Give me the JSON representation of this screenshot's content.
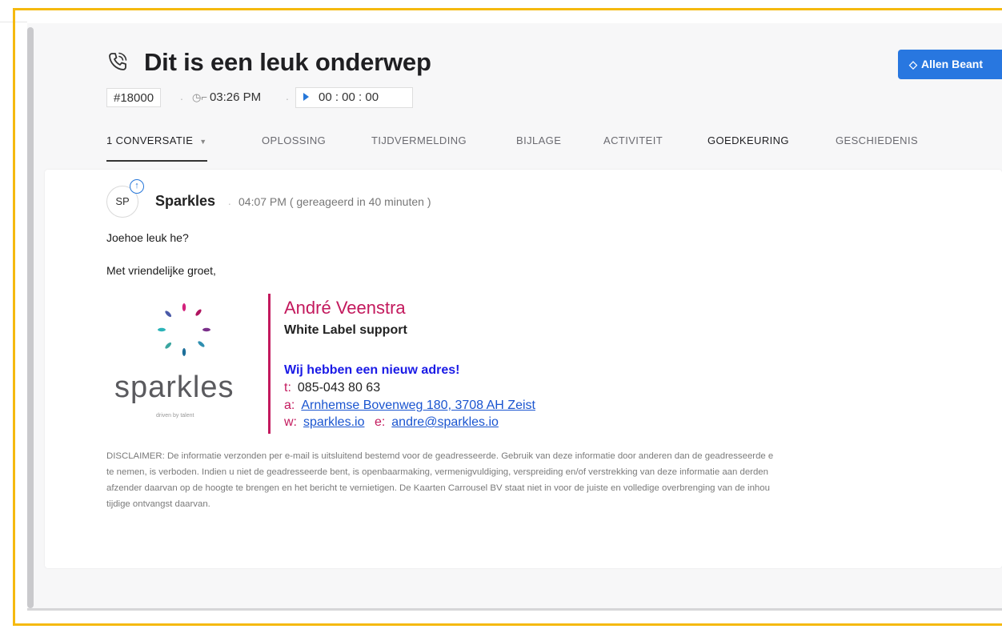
{
  "header": {
    "title": "Dit is een leuk onderwep",
    "ticket_id": "#18000",
    "time": "03:26 PM",
    "timer": "00 : 00 : 00",
    "assign_button": "Allen Beant"
  },
  "tabs": [
    {
      "label": "1 CONVERSATIE"
    },
    {
      "label": "OPLOSSING"
    },
    {
      "label": "TIJDVERMELDING"
    },
    {
      "label": "BIJLAGE"
    },
    {
      "label": "ACTIVITEIT"
    },
    {
      "label": "GOEDKEURING"
    },
    {
      "label": "GESCHIEDENIS"
    }
  ],
  "message": {
    "avatar_initials": "SP",
    "sender": "Sparkles",
    "sent_info": "04:07 PM ( gereageerd in 40 minuten )",
    "body_line1": "Joehoe leuk he?",
    "body_line2": "Met vriendelijke groet,"
  },
  "signature": {
    "logo_word": "sparkles",
    "logo_tagline": "driven by talent",
    "name": "André Veenstra",
    "role": "White Label support",
    "news": "Wij hebben een nieuw adres!",
    "phone_key": "t:",
    "phone": "085-043 80 63",
    "address_key": "a:",
    "address": "Arnhemse Bovenweg 180, 3708 AH Zeist",
    "web_key": "w:",
    "web": "sparkles.io",
    "email_key": "e:",
    "email": "andre@sparkles.io"
  },
  "disclaimer": [
    "DISCLAIMER: De informatie verzonden per e-mail is uitsluitend bestemd voor de geadresseerde. Gebruik van deze informatie door anderen dan de geadresseerde e",
    "te nemen, is verboden. Indien u niet de geadresseerde bent, is openbaarmaking, vermenigvuldiging, verspreiding en/of verstrekking van deze informatie aan derden",
    "afzender daarvan op de hoogte te brengen en het bericht te vernietigen. De Kaarten Carrousel BV staat niet in voor de juiste en volledige overbrenging van de inhou",
    "tijdige ontvangst daarvan."
  ],
  "colors": {
    "highlight_frame": "#f5b90f",
    "primary_button": "#2877e0",
    "signature_accent": "#c3195d",
    "news_text": "#1a1ae6"
  }
}
